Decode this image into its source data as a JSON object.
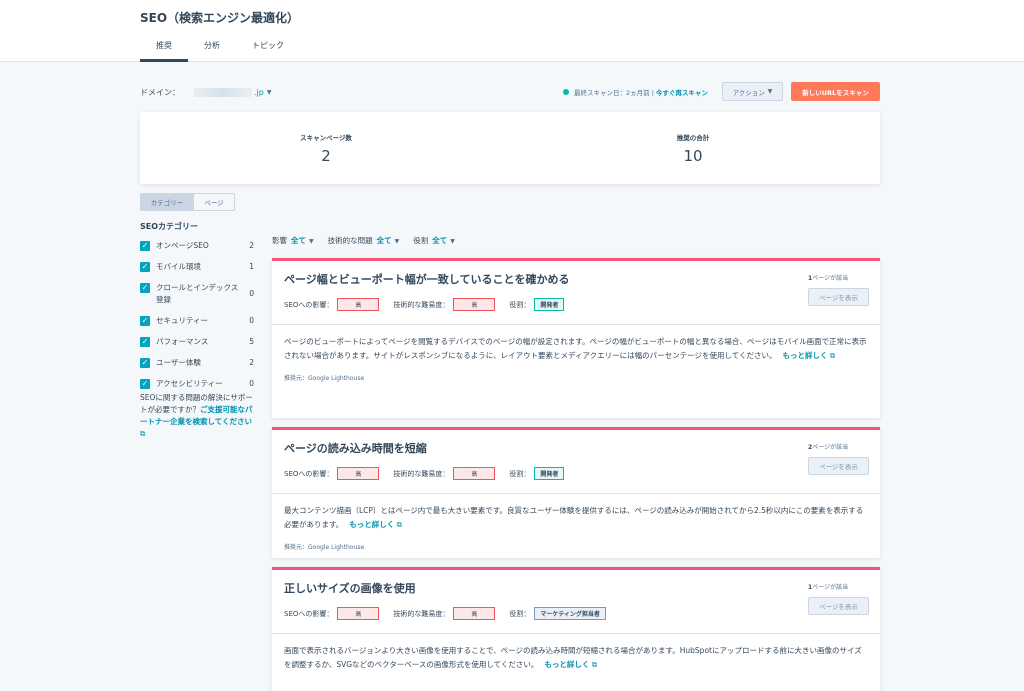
{
  "header": {
    "title": "SEO（検索エンジン最適化）",
    "tabs": [
      {
        "label": "推奨"
      },
      {
        "label": "分析"
      },
      {
        "label": "トピック"
      }
    ]
  },
  "toolbar": {
    "domain_label": "ドメイン：",
    "domain_suffix": ".jp",
    "scan_status": "最終スキャン日：2ヵ月前 |",
    "rescan_label": "今すぐ再スキャン",
    "action_label": "アクション",
    "scan_new_label": "新しいURLをスキャン"
  },
  "stats": {
    "pages_label": "スキャンページ数",
    "pages_value": "2",
    "recs_label": "推奨の合計",
    "recs_value": "10"
  },
  "view_toggle": {
    "category": "カテゴリー",
    "page": "ページ"
  },
  "sidebar": {
    "title": "SEOカテゴリー",
    "items": [
      {
        "label": "オンページSEO",
        "count": "2"
      },
      {
        "label": "モバイル環境",
        "count": "1"
      },
      {
        "label": "クロールとインデックス登録",
        "count": "0"
      },
      {
        "label": "セキュリティー",
        "count": "0"
      },
      {
        "label": "パフォーマンス",
        "count": "5"
      },
      {
        "label": "ユーザー体験",
        "count": "2"
      },
      {
        "label": "アクセシビリティー",
        "count": "0"
      }
    ],
    "help_text": "SEOに関する問題の解決にサポートが必要ですか？",
    "help_link": "ご支援可能なパートナー企業を検索してください"
  },
  "filters": [
    {
      "label": "影響",
      "value": "全て"
    },
    {
      "label": "技術的な問題",
      "value": "全て"
    },
    {
      "label": "役割",
      "value": "全て"
    }
  ],
  "common": {
    "impact_label": "SEOへの影響：",
    "difficulty_label": "技術的な難易度：",
    "role_label": "役割：",
    "view_pages": "ページを表示",
    "more": "もっと詳しく",
    "source": "推奨元：Google Lighthouse"
  },
  "cards": [
    {
      "title": "ページ幅とビューポート幅が一致していることを確かめる",
      "impact": "高",
      "difficulty": "高",
      "role": "開発者",
      "count": "1",
      "count_suffix": "ページが該当",
      "body": "ページのビューポートによってページを閲覧するデバイスでのページの幅が設定されます。ページの幅がビューポートの幅と異なる場合、ページはモバイル画面で正常に表示されない場合があります。サイトがレスポンシブになるように、レイアウト要素とメディアクエリーには幅のパーセンテージを使用してください。"
    },
    {
      "title": "ページの読み込み時間を短縮",
      "impact": "高",
      "difficulty": "高",
      "role": "開発者",
      "count": "2",
      "count_suffix": "ページが該当",
      "body": "最大コンテンツ描画（LCP）とはページ内で最も大きい要素です。良質なユーザー体験を提供するには、ページの読み込みが開始されてから2.5秒以内にこの要素を表示する必要があります。"
    },
    {
      "title": "正しいサイズの画像を使用",
      "impact": "高",
      "difficulty": "高",
      "role": "マーケティング担当者",
      "count": "1",
      "count_suffix": "ページが該当",
      "body": "画面で表示されるバージョンより大きい画像を使用することで、ページの読み込み時間が短縮される場合があります。HubSpotにアップロードする前に大きい画像のサイズを調整するか、SVGなどのベクターベースの画像形式を使用してください。"
    }
  ]
}
